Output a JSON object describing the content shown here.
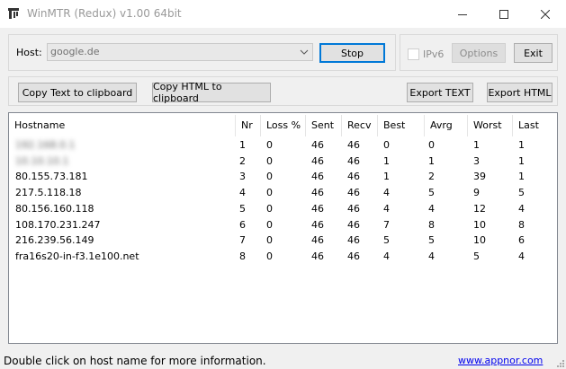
{
  "window": {
    "title": "WinMTR (Redux) v1.00 64bit"
  },
  "controls": {
    "host_label": "Host:",
    "host_value": "google.de",
    "stop_label": "Stop",
    "ipv6_label": "IPv6",
    "options_label": "Options",
    "exit_label": "Exit",
    "copy_text_label": "Copy Text to clipboard",
    "copy_html_label": "Copy HTML to clipboard",
    "export_text_label": "Export TEXT",
    "export_html_label": "Export HTML"
  },
  "table": {
    "columns": [
      "Hostname",
      "Nr",
      "Loss %",
      "Sent",
      "Recv",
      "Best",
      "Avrg",
      "Worst",
      "Last"
    ],
    "rows": [
      {
        "host": "192.168.0.1",
        "blurred": true,
        "values": [
          "1",
          "0",
          "46",
          "46",
          "0",
          "0",
          "1",
          "1"
        ]
      },
      {
        "host": "10.10.10.1",
        "blurred": true,
        "values": [
          "2",
          "0",
          "46",
          "46",
          "1",
          "1",
          "3",
          "1"
        ]
      },
      {
        "host": "80.155.73.181",
        "blurred": false,
        "values": [
          "3",
          "0",
          "46",
          "46",
          "1",
          "2",
          "39",
          "1"
        ]
      },
      {
        "host": "217.5.118.18",
        "blurred": false,
        "values": [
          "4",
          "0",
          "46",
          "46",
          "4",
          "5",
          "9",
          "5"
        ]
      },
      {
        "host": "80.156.160.118",
        "blurred": false,
        "values": [
          "5",
          "0",
          "46",
          "46",
          "4",
          "4",
          "12",
          "4"
        ]
      },
      {
        "host": "108.170.231.247",
        "blurred": false,
        "values": [
          "6",
          "0",
          "46",
          "46",
          "7",
          "8",
          "10",
          "8"
        ]
      },
      {
        "host": "216.239.56.149",
        "blurred": false,
        "values": [
          "7",
          "0",
          "46",
          "46",
          "5",
          "5",
          "10",
          "6"
        ]
      },
      {
        "host": "fra16s20-in-f3.1e100.net",
        "blurred": false,
        "values": [
          "8",
          "0",
          "46",
          "46",
          "4",
          "4",
          "5",
          "4"
        ]
      }
    ]
  },
  "status": {
    "text": "Double click on host name for more information.",
    "link": "www.appnor.com"
  }
}
